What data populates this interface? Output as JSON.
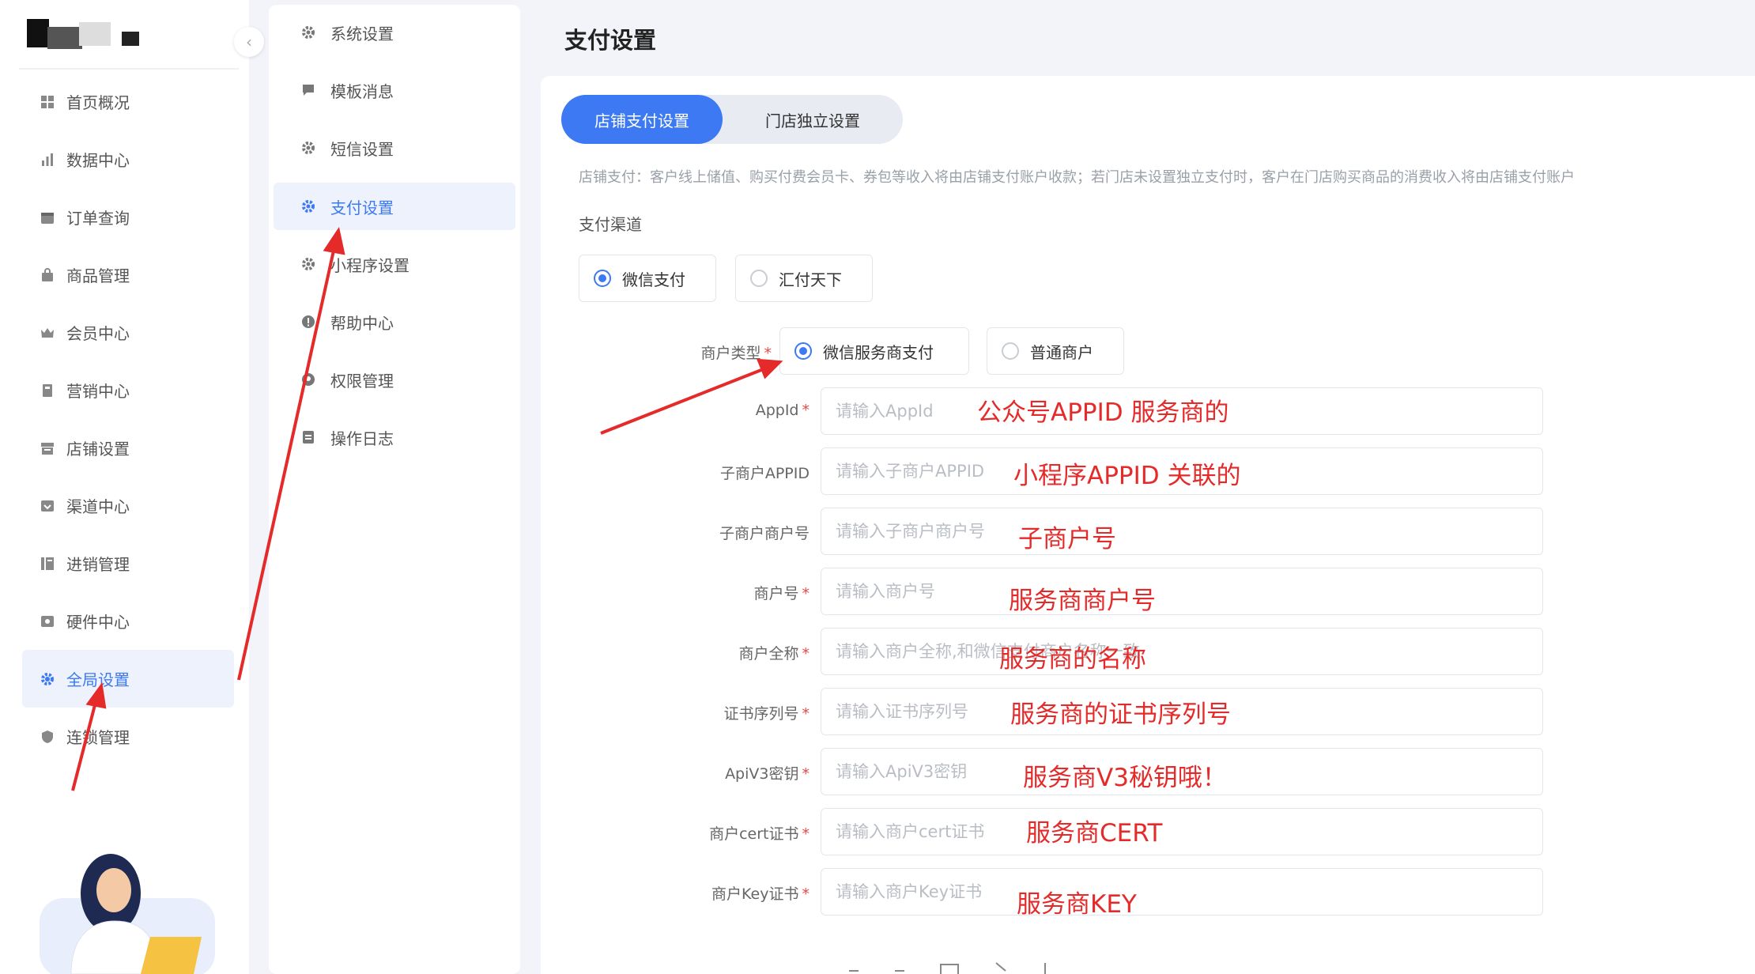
{
  "sidebar": {
    "items": [
      {
        "label": "首页概况",
        "icon": "dashboard-icon"
      },
      {
        "label": "数据中心",
        "icon": "bar-chart-icon"
      },
      {
        "label": "订单查询",
        "icon": "calendar-icon"
      },
      {
        "label": "商品管理",
        "icon": "bag-icon"
      },
      {
        "label": "会员中心",
        "icon": "crown-icon"
      },
      {
        "label": "营销中心",
        "icon": "gift-icon"
      },
      {
        "label": "店铺设置",
        "icon": "store-icon"
      },
      {
        "label": "渠道中心",
        "icon": "channel-icon"
      },
      {
        "label": "进销管理",
        "icon": "inventory-icon"
      },
      {
        "label": "硬件中心",
        "icon": "hardware-icon"
      },
      {
        "label": "全局设置",
        "icon": "gear-icon",
        "active": true
      },
      {
        "label": "连锁管理",
        "icon": "shield-icon"
      }
    ]
  },
  "subnav": {
    "items": [
      {
        "label": "系统设置",
        "icon": "gear-icon"
      },
      {
        "label": "模板消息",
        "icon": "message-icon"
      },
      {
        "label": "短信设置",
        "icon": "gear-icon"
      },
      {
        "label": "支付设置",
        "icon": "gear-icon",
        "active": true
      },
      {
        "label": "小程序设置",
        "icon": "gear-icon"
      },
      {
        "label": "帮助中心",
        "icon": "help-icon"
      },
      {
        "label": "权限管理",
        "icon": "key-icon"
      },
      {
        "label": "操作日志",
        "icon": "log-icon"
      }
    ]
  },
  "page": {
    "title": "支付设置"
  },
  "tabs": [
    {
      "label": "店铺支付设置",
      "active": true
    },
    {
      "label": "门店独立设置",
      "active": false
    }
  ],
  "description": "店铺支付：客户线上储值、购买付费会员卡、券包等收入将由店铺支付账户收款；若门店未设置独立支付时，客户在门店购买商品的消费收入将由店铺支付账户",
  "payment_channel": {
    "label": "支付渠道",
    "options": [
      {
        "label": "微信支付",
        "selected": true
      },
      {
        "label": "汇付天下",
        "selected": false
      }
    ]
  },
  "merchant_type": {
    "label": "商户类型",
    "options": [
      {
        "label": "微信服务商支付",
        "selected": true
      },
      {
        "label": "普通商户",
        "selected": false
      }
    ]
  },
  "form": {
    "fields": [
      {
        "label": "AppId",
        "required": true,
        "placeholder": "请输入AppId",
        "note": "公众号APPID 服务商的"
      },
      {
        "label": "子商户APPID",
        "required": false,
        "placeholder": "请输入子商户APPID",
        "note": "小程序APPID 关联的"
      },
      {
        "label": "子商户商户号",
        "required": false,
        "placeholder": "请输入子商户商户号",
        "note": "子商户号"
      },
      {
        "label": "商户号",
        "required": true,
        "placeholder": "请输入商户号",
        "note": "服务商商户号"
      },
      {
        "label": "商户全称",
        "required": true,
        "placeholder": "请输入商户全称,和微信支付商户名称一致",
        "note": "服务商的名称"
      },
      {
        "label": "证书序列号",
        "required": true,
        "placeholder": "请输入证书序列号",
        "note": "服务商的证书序列号"
      },
      {
        "label": "ApiV3密钥",
        "required": true,
        "placeholder": "请输入ApiV3密钥",
        "note": "服务商V3秘钥哦！"
      },
      {
        "label": "商户cert证书",
        "required": true,
        "placeholder": "请输入商户cert证书",
        "note": "服务商CERT"
      },
      {
        "label": "商户Key证书",
        "required": true,
        "placeholder": "请输入商户Key证书",
        "note": "服务商KEY"
      }
    ]
  },
  "colors": {
    "accent": "#3d79f2",
    "annotation": "#e52a2a",
    "required": "#e54848"
  }
}
